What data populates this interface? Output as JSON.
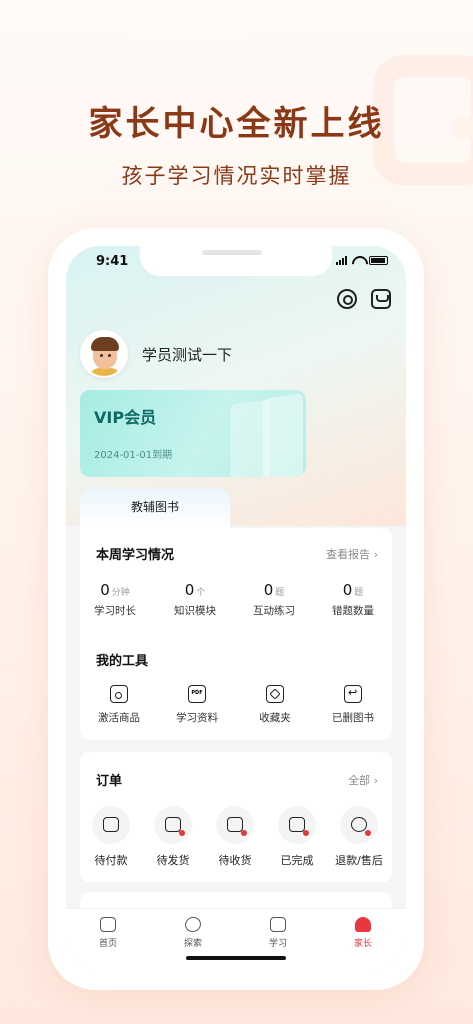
{
  "hero": {
    "title": "家长中心全新上线",
    "subtitle": "孩子学习情况实时掌握"
  },
  "status_bar": {
    "time": "9:41"
  },
  "user": {
    "name": "学员测试一下"
  },
  "vip": {
    "title": "VIP会员",
    "expiry": "2024-01-01到期"
  },
  "tab": {
    "label": "教辅图书"
  },
  "weekly": {
    "title": "本周学习情况",
    "more": "查看报告 ›",
    "stats": [
      {
        "value": "0",
        "unit": "分钟",
        "label": "学习时长"
      },
      {
        "value": "0",
        "unit": "个",
        "label": "知识模块"
      },
      {
        "value": "0",
        "unit": "题",
        "label": "互动练习"
      },
      {
        "value": "0",
        "unit": "题",
        "label": "错题数量"
      }
    ]
  },
  "tools": {
    "title": "我的工具",
    "items": [
      {
        "label": "激活商品",
        "icon": "activate-icon"
      },
      {
        "label": "学习资料",
        "icon": "pdf-icon",
        "glyph": "PDF"
      },
      {
        "label": "收藏夹",
        "icon": "favorites-icon"
      },
      {
        "label": "已删图书",
        "icon": "deleted-books-icon"
      }
    ]
  },
  "orders": {
    "title": "订单",
    "more": "全部 ›",
    "items": [
      {
        "label": "待付款",
        "icon": "wallet-icon"
      },
      {
        "label": "待发货",
        "icon": "truck-icon"
      },
      {
        "label": "待收货",
        "icon": "package-icon"
      },
      {
        "label": "已完成",
        "icon": "completed-icon"
      },
      {
        "label": "退款/售后",
        "icon": "refund-icon"
      }
    ]
  },
  "tabbar": {
    "items": [
      {
        "label": "首页",
        "icon": "home-icon",
        "active": false
      },
      {
        "label": "探索",
        "icon": "explore-icon",
        "active": false
      },
      {
        "label": "学习",
        "icon": "study-icon",
        "active": false
      },
      {
        "label": "家长",
        "icon": "parent-icon",
        "active": true
      }
    ]
  },
  "colors": {
    "hero_text": "#8a3815",
    "vip_text": "#0e6a63",
    "active_tab": "#e8373f",
    "badge_red": "#e2383f"
  }
}
